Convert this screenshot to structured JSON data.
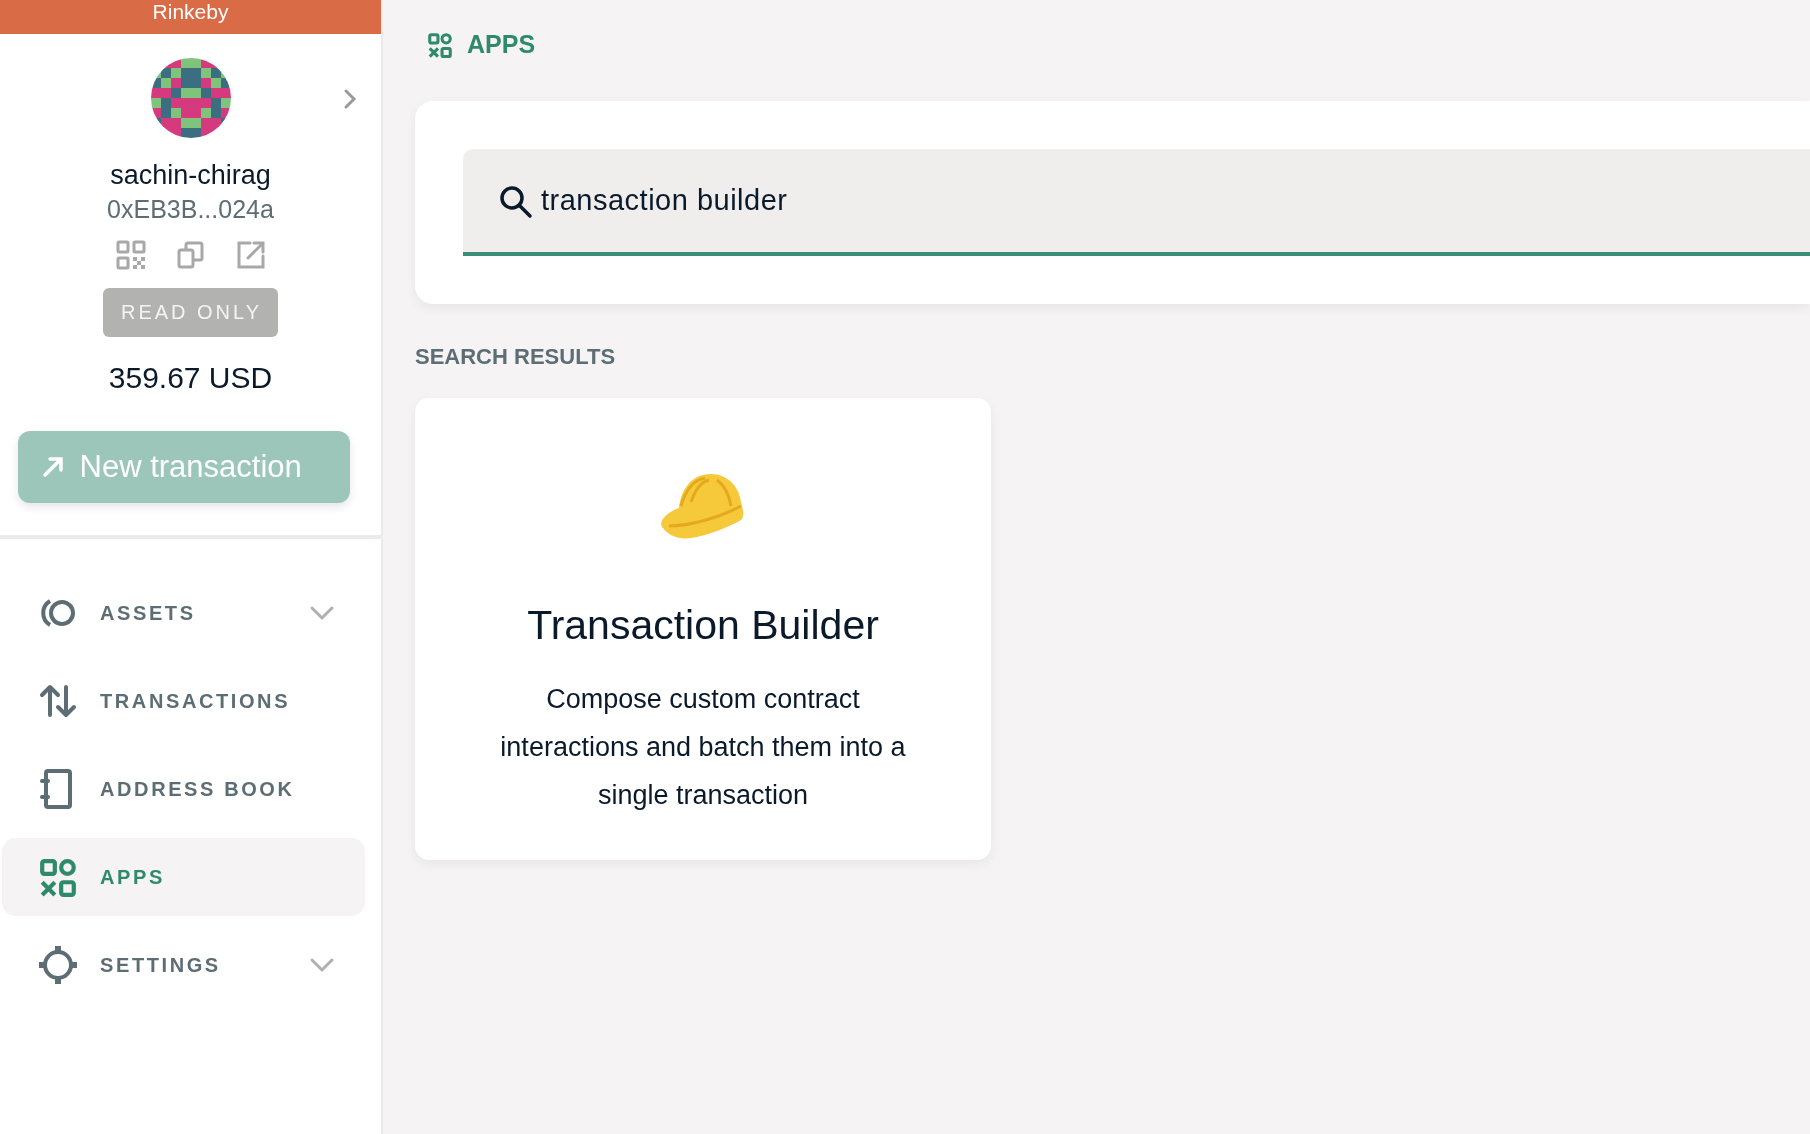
{
  "network_bar": {
    "label": "Rinkeby"
  },
  "account": {
    "name": "sachin-chirag",
    "address": "0xEB3B...024a",
    "badge": "READ ONLY",
    "balance": "359.67 USD"
  },
  "new_transaction_button": {
    "label": "New transaction",
    "disabled": true
  },
  "nav": [
    {
      "label": "ASSETS",
      "expandable": true,
      "selected": false
    },
    {
      "label": "TRANSACTIONS",
      "expandable": false,
      "selected": false
    },
    {
      "label": "ADDRESS BOOK",
      "expandable": false,
      "selected": false
    },
    {
      "label": "APPS",
      "expandable": false,
      "selected": true
    },
    {
      "label": "SETTINGS",
      "expandable": true,
      "selected": false
    }
  ],
  "page_title": "APPS",
  "search": {
    "value": "transaction builder"
  },
  "results_heading": "SEARCH RESULTS",
  "apps": [
    {
      "name": "Transaction Builder",
      "description": "Compose custom contract interactions and batch them into a single transaction"
    }
  ]
}
